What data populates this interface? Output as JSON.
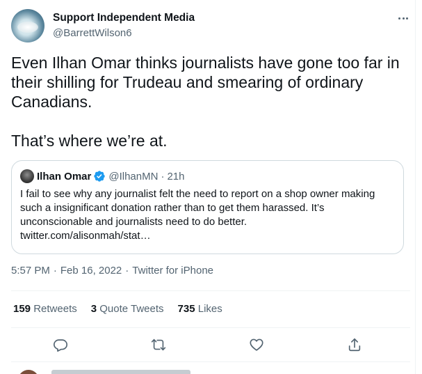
{
  "tweet": {
    "author": {
      "display_name": "Support Independent Media",
      "handle": "@BarrettWilson6"
    },
    "text_lines": [
      "Even Ilhan Omar thinks journalists have gone too far in their shilling for Trudeau and smearing of ordinary Canadians.",
      "That’s where we’re at."
    ],
    "quoted": {
      "display_name": "Ilhan Omar",
      "handle": "@IlhanMN",
      "separator": "·",
      "time": "21h",
      "text": "I fail to see why any journalist felt the need to report on a shop owner making such a insignificant donation rather than to get them harassed. It’s unconscionable and journalists need to do better.",
      "link": "twitter.com/alisonmah/stat…"
    },
    "meta": {
      "time": "5:57 PM",
      "date": "Feb 16, 2022",
      "source": "Twitter for iPhone",
      "dot": "·"
    },
    "stats": {
      "retweets_count": "159",
      "retweets_label": "Retweets",
      "quotes_count": "3",
      "quotes_label": "Quote Tweets",
      "likes_count": "735",
      "likes_label": "Likes"
    },
    "actions": [
      "reply-icon",
      "retweet-icon",
      "like-icon",
      "share-icon"
    ]
  },
  "colors": {
    "text": "#0f1419",
    "secondary": "#536471",
    "border": "#cfd9de",
    "divider": "#eff3f4",
    "verified": "#1d9bf0"
  }
}
